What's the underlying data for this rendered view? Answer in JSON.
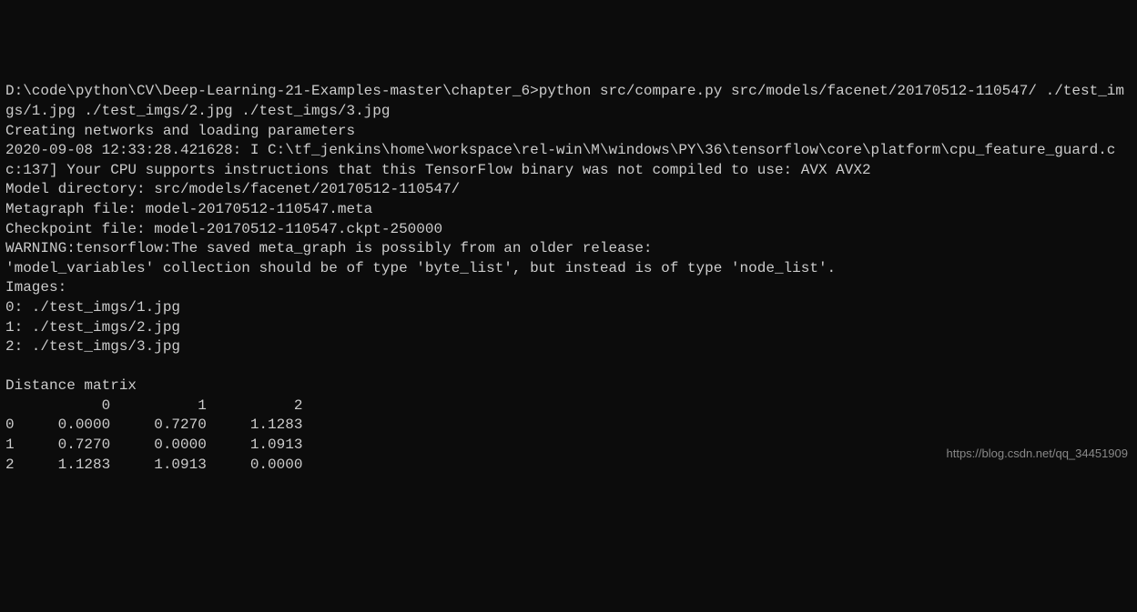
{
  "prompt": {
    "path": "D:\\code\\python\\CV\\Deep-Learning-21-Examples-master\\chapter_6>",
    "command": "python src/compare.py src/models/facenet/20170512-110547/ ./test_imgs/1.jpg ./test_imgs/2.jpg ./test_imgs/3.jpg"
  },
  "output": {
    "creating": "Creating networks and loading parameters",
    "tf_log": "2020-09-08 12:33:28.421628: I C:\\tf_jenkins\\home\\workspace\\rel-win\\M\\windows\\PY\\36\\tensorflow\\core\\platform\\cpu_feature_guard.cc:137] Your CPU supports instructions that this TensorFlow binary was not compiled to use: AVX AVX2",
    "model_dir": "Model directory: src/models/facenet/20170512-110547/",
    "metagraph": "Metagraph file: model-20170512-110547.meta",
    "checkpoint": "Checkpoint file: model-20170512-110547.ckpt-250000",
    "warning": "WARNING:tensorflow:The saved meta_graph is possibly from an older release:",
    "warning2": "'model_variables' collection should be of type 'byte_list', but instead is of type 'node_list'.",
    "images_header": "Images:",
    "images": [
      "0: ./test_imgs/1.jpg",
      "1: ./test_imgs/2.jpg",
      "2: ./test_imgs/3.jpg"
    ],
    "matrix_header": "Distance matrix",
    "matrix": {
      "cols": [
        "0",
        "1",
        "2"
      ],
      "rows": [
        {
          "idx": "0",
          "vals": [
            "0.0000",
            "0.7270",
            "1.1283"
          ]
        },
        {
          "idx": "1",
          "vals": [
            "0.7270",
            "0.0000",
            "1.0913"
          ]
        },
        {
          "idx": "2",
          "vals": [
            "1.1283",
            "1.0913",
            "0.0000"
          ]
        }
      ]
    }
  },
  "watermark": "https://blog.csdn.net/qq_34451909"
}
